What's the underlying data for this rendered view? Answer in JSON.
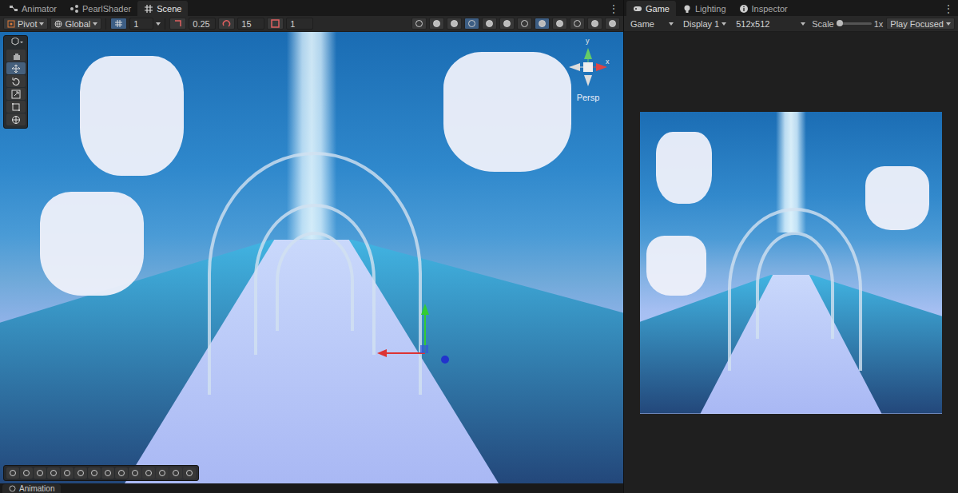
{
  "scene_panel": {
    "tabs": [
      {
        "label": "Animator",
        "selected": false
      },
      {
        "label": "PearlShader",
        "selected": false
      },
      {
        "label": "Scene",
        "selected": true
      }
    ],
    "menu": "⋮",
    "toolbar": {
      "pivot": "Pivot",
      "space": "Global",
      "grid_size": "1",
      "snap_move": "0.25",
      "snap_rotate": "15",
      "snap_scale": "1"
    },
    "tools": [
      {
        "kind": "hand",
        "selected": false
      },
      {
        "kind": "move",
        "selected": true
      },
      {
        "kind": "rotate",
        "selected": false
      },
      {
        "kind": "scale",
        "selected": false
      },
      {
        "kind": "rect",
        "selected": false
      },
      {
        "kind": "transform",
        "selected": false
      }
    ],
    "view": {
      "projection": "Persp",
      "axis_labels": [
        "y",
        "x"
      ]
    }
  },
  "bottom_panel": {
    "tab": "Animation"
  },
  "game_panel": {
    "tabs": [
      {
        "label": "Game",
        "selected": true
      },
      {
        "label": "Lighting",
        "selected": false
      },
      {
        "label": "Inspector",
        "selected": false
      }
    ],
    "menu": "⋮",
    "toolbar": {
      "view": "Game",
      "display": "Display 1",
      "resolution": "512x512",
      "scale_label": "Scale",
      "scale_level": 0.1,
      "scale_value": "1x",
      "play_mode": "Play Focused"
    }
  }
}
